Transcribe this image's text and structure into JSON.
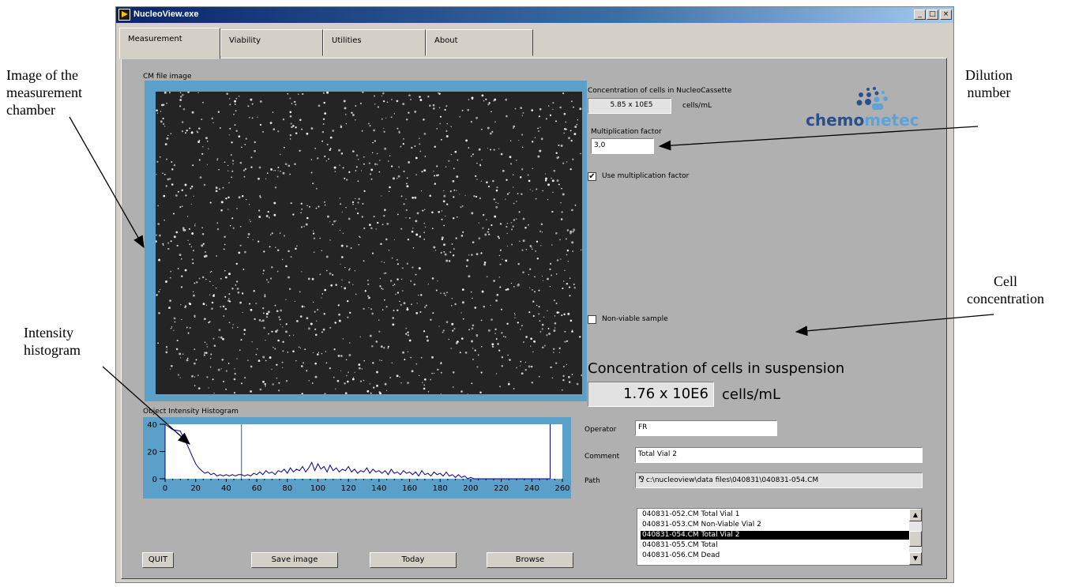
{
  "window": {
    "title": "NucleoView.exe",
    "controls": [
      "_",
      "□",
      "×"
    ]
  },
  "tabs": [
    "Measurement",
    "Viability",
    "Utilities",
    "About"
  ],
  "image_panel": {
    "label": "CM file image"
  },
  "histogram": {
    "label": "Object Intensity Histogram",
    "y_ticks": [
      "40",
      "20",
      "0"
    ],
    "x_ticks": [
      "0",
      "20",
      "40",
      "60",
      "80",
      "100",
      "120",
      "140",
      "160",
      "180",
      "200",
      "220",
      "240",
      "260"
    ],
    "y_max": 40,
    "x_max": 260,
    "cursor_positions": [
      0,
      50,
      252
    ],
    "curve": [
      [
        0,
        40
      ],
      [
        5,
        36
      ],
      [
        10,
        35
      ],
      [
        12,
        30
      ],
      [
        14,
        26
      ],
      [
        16,
        21
      ],
      [
        18,
        16
      ],
      [
        20,
        11
      ],
      [
        22,
        8
      ],
      [
        24,
        6
      ],
      [
        26,
        4
      ],
      [
        28,
        5
      ],
      [
        30,
        3
      ],
      [
        32,
        4
      ],
      [
        34,
        2
      ],
      [
        36,
        3
      ],
      [
        38,
        2
      ],
      [
        40,
        3
      ],
      [
        42,
        2
      ],
      [
        44,
        3
      ],
      [
        46,
        2
      ],
      [
        48,
        3
      ],
      [
        50,
        3
      ],
      [
        52,
        2
      ],
      [
        54,
        3
      ],
      [
        56,
        2
      ],
      [
        58,
        4
      ],
      [
        60,
        3
      ],
      [
        62,
        5
      ],
      [
        64,
        3
      ],
      [
        66,
        6
      ],
      [
        68,
        4
      ],
      [
        70,
        5
      ],
      [
        72,
        3
      ],
      [
        74,
        6
      ],
      [
        76,
        5
      ],
      [
        78,
        7
      ],
      [
        80,
        4
      ],
      [
        82,
        8
      ],
      [
        84,
        5
      ],
      [
        86,
        7
      ],
      [
        88,
        6
      ],
      [
        90,
        9
      ],
      [
        92,
        5
      ],
      [
        94,
        8
      ],
      [
        96,
        12
      ],
      [
        98,
        6
      ],
      [
        100,
        11
      ],
      [
        102,
        7
      ],
      [
        104,
        9
      ],
      [
        106,
        5
      ],
      [
        108,
        10
      ],
      [
        110,
        6
      ],
      [
        112,
        8
      ],
      [
        114,
        5
      ],
      [
        116,
        7
      ],
      [
        118,
        6
      ],
      [
        120,
        9
      ],
      [
        122,
        5
      ],
      [
        124,
        7
      ],
      [
        126,
        4
      ],
      [
        128,
        6
      ],
      [
        130,
        5
      ],
      [
        132,
        8
      ],
      [
        134,
        4
      ],
      [
        136,
        7
      ],
      [
        138,
        5
      ],
      [
        140,
        6
      ],
      [
        142,
        4
      ],
      [
        144,
        6
      ],
      [
        146,
        3
      ],
      [
        148,
        7
      ],
      [
        150,
        4
      ],
      [
        152,
        5
      ],
      [
        154,
        3
      ],
      [
        156,
        6
      ],
      [
        158,
        4
      ],
      [
        160,
        5
      ],
      [
        162,
        3
      ],
      [
        164,
        5
      ],
      [
        166,
        2
      ],
      [
        168,
        6
      ],
      [
        170,
        3
      ],
      [
        172,
        4
      ],
      [
        174,
        2
      ],
      [
        176,
        5
      ],
      [
        178,
        3
      ],
      [
        180,
        4
      ],
      [
        182,
        2
      ],
      [
        184,
        5
      ],
      [
        186,
        2
      ],
      [
        188,
        3
      ],
      [
        190,
        1
      ],
      [
        192,
        3
      ],
      [
        194,
        1
      ],
      [
        196,
        2
      ],
      [
        198,
        0
      ],
      [
        200,
        1
      ],
      [
        202,
        0
      ],
      [
        252,
        0
      ]
    ]
  },
  "cassette": {
    "label": "Concentration of cells in NucleoCassette",
    "value": "5.85 x 10E5",
    "unit": "cells/mL"
  },
  "multiplication": {
    "label": "Multiplication factor",
    "value": "3,0",
    "use_label": "Use multiplication factor",
    "use_checked": "✔"
  },
  "non_viable": {
    "label": "Non-viable sample"
  },
  "suspension": {
    "label": "Concentration of cells in suspension",
    "value": "1.76 x 10E6",
    "unit": "cells/mL"
  },
  "meta": {
    "operator_label": "Operator",
    "operator_value": "FR",
    "comment_label": "Comment",
    "comment_value": "Total Vial 2",
    "path_label": "Path",
    "path_value": "c:\\nucleoview\\data files\\040831\\040831-054.CM"
  },
  "file_list": [
    "040831-052.CM  Total Vial 1",
    "040831-053.CM  Non-Viable Vial 2",
    "040831-054.CM  Total Vial 2",
    "040831-055.CM  Total",
    "040831-056.CM  Dead"
  ],
  "file_list_selected": 2,
  "buttons": {
    "quit": "QUIT",
    "save": "Save image",
    "today": "Today",
    "browse": "Browse"
  },
  "logo": {
    "part1": "chemo",
    "part2": "metec"
  },
  "annotations": {
    "image_line1": "Image of the",
    "image_line2": "measurement",
    "image_line3": "chamber",
    "hist_line1": "Intensity",
    "hist_line2": "histogram",
    "dilution_line1": "Dilution",
    "dilution_line2": "number",
    "cell_line1": "Cell",
    "cell_line2": "concentration"
  },
  "colors": {
    "frame": "#5aa0c8",
    "panel": "#b0b0b0",
    "title_bar": "#0a246a",
    "plot_line": "#00008b",
    "cursor": "#008080",
    "logo_blue": "#2b4f8a",
    "logo_light": "#5ea3d6"
  }
}
